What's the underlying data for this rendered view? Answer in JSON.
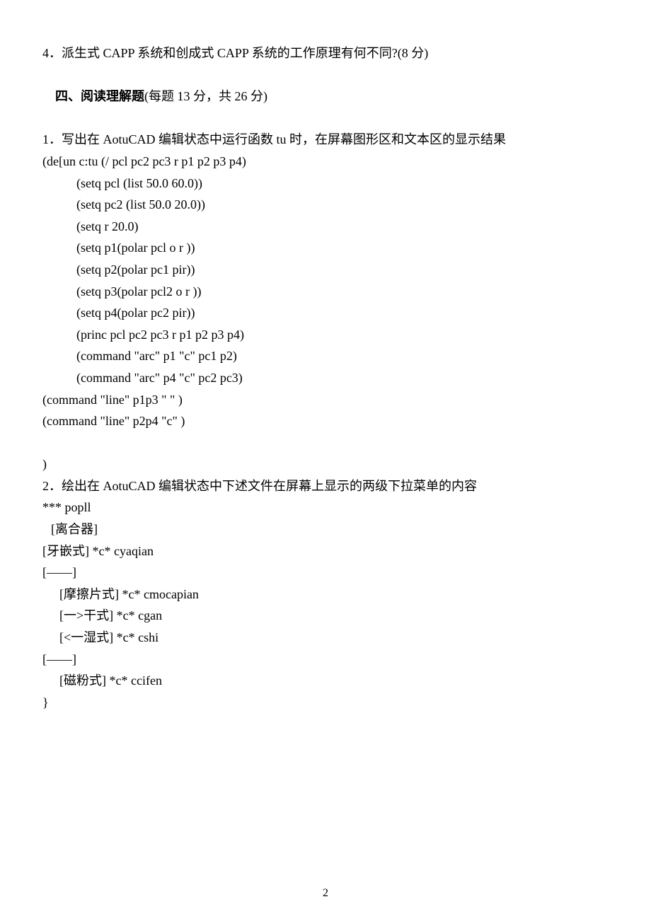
{
  "q4": "4．派生式 CAPP 系统和创成式 CAPP 系统的工作原理有何不同?(8 分)",
  "section4": {
    "label": "四、",
    "title": "阅读理解题",
    "scoring": "(每题 13 分，共 26 分)"
  },
  "q1": {
    "prompt": "1．写出在 AotuCAD 编辑状态中运行函数 tu 时，在屏幕图形区和文本区的显示结果",
    "code": [
      "(de[un c:tu (/ pcl pc2 pc3 r p1 p2 p3 p4)",
      "(setq pcl (list 50.0 60.0))",
      "(setq pc2 (list 50.0 20.0))",
      "(setq r 20.0)",
      "(setq p1(polar pcl o r ))",
      "(setq p2(polar pc1 pir))",
      "(setq p3(polar pcl2 o r ))",
      "(setq p4(polar pc2 pir))",
      "(princ pcl pc2 pc3 r p1 p2 p3 p4)",
      "(command \"arc\" p1 \"c\" pc1 p2)",
      "(command \"arc\" p4 \"c\" pc2 pc3)"
    ],
    "tail": [
      "(command \"line\" p1p3 \" \" )",
      "(command \"line\" p2p4 \"c\" )",
      "",
      ")"
    ]
  },
  "q2": {
    "prompt": "2．绘出在 AotuCAD 编辑状态中下述文件在屏幕上显示的两级下拉菜单的内容",
    "lines": {
      "l0": "*** popll",
      "l1": "[离合器]",
      "l2": "[牙嵌式] *c* cyaqian",
      "l3": "[——]",
      "l4": "[摩擦片式] *c* cmocapian",
      "l5": "[一>干式] *c* cgan",
      "l6": "[<一湿式] *c* cshi",
      "l7": "[——]",
      "l8": "[磁粉式] *c* ccifen",
      "l9": "}"
    }
  },
  "pageNumber": "2"
}
